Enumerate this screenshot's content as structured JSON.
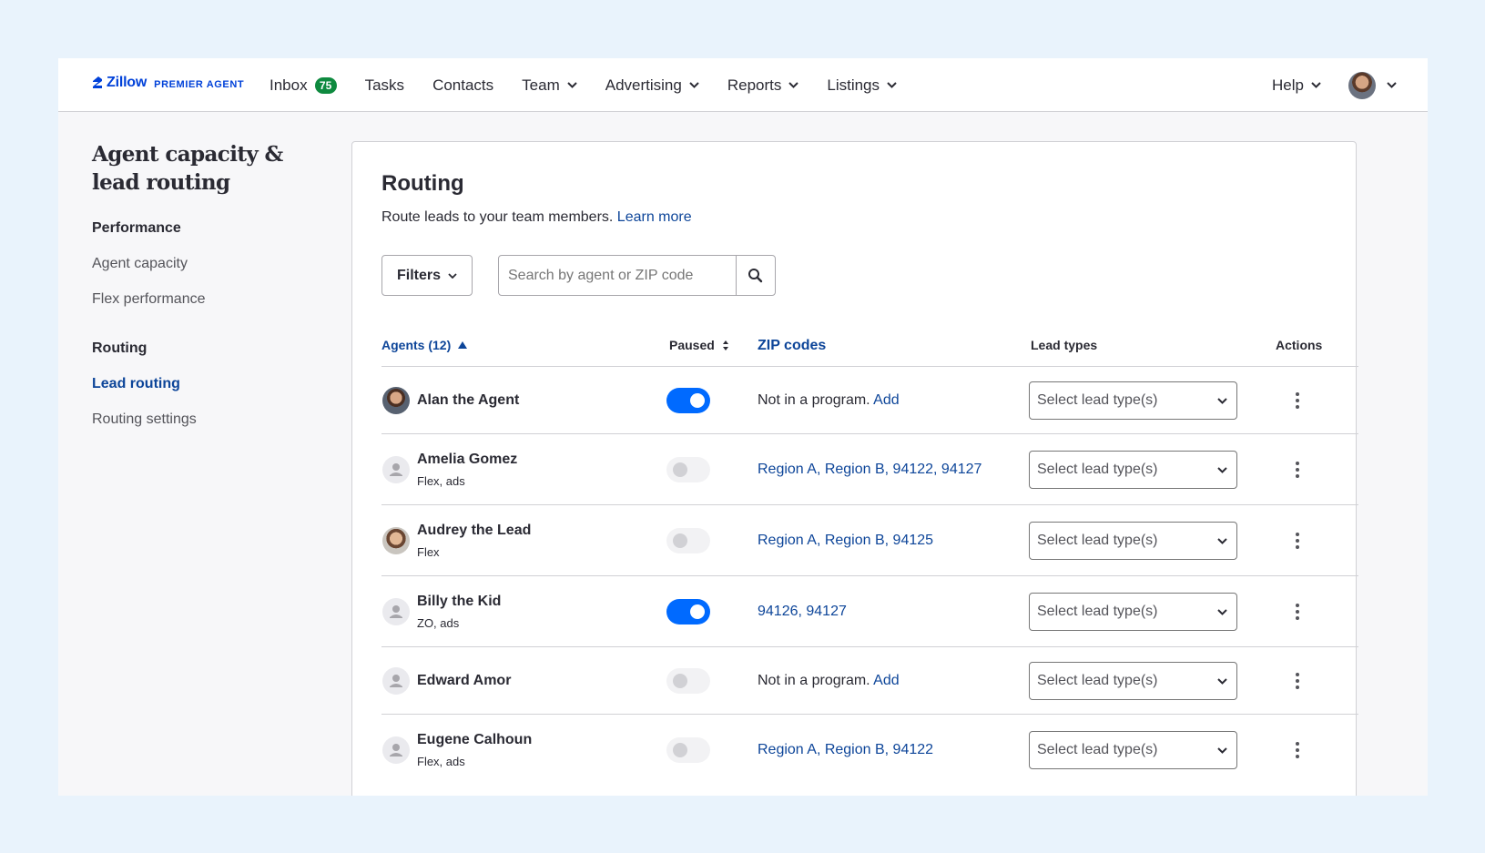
{
  "brand": {
    "name": "Zillow",
    "product": "PREMIER AGENT",
    "color": "#0041d9"
  },
  "nav": {
    "items": [
      {
        "label": "Inbox",
        "badge": "75",
        "dropdown": false
      },
      {
        "label": "Tasks",
        "dropdown": false
      },
      {
        "label": "Contacts",
        "dropdown": false
      },
      {
        "label": "Team",
        "dropdown": true
      },
      {
        "label": "Advertising",
        "dropdown": true
      },
      {
        "label": "Reports",
        "dropdown": true
      },
      {
        "label": "Listings",
        "dropdown": true
      }
    ],
    "help_label": "Help"
  },
  "sidebar": {
    "title": "Agent capacity & lead routing",
    "sections": [
      {
        "heading": "Performance",
        "links": [
          "Agent capacity",
          "Flex performance"
        ]
      },
      {
        "heading": "Routing",
        "links": [
          "Lead routing",
          "Routing settings"
        ]
      }
    ],
    "active_link": "Lead routing"
  },
  "main": {
    "title": "Routing",
    "subtitle": "Route leads to your team members.",
    "learn_more": "Learn more",
    "filters_label": "Filters",
    "search_placeholder": "Search by agent or ZIP code",
    "columns": {
      "agents": "Agents (12)",
      "paused": "Paused",
      "zip": "ZIP codes",
      "lead_types": "Lead types",
      "actions": "Actions"
    },
    "select_placeholder": "Select lead type(s)",
    "rows": [
      {
        "name": "Alan the Agent",
        "sub": "",
        "avatar": "photo",
        "paused": true,
        "zip_prefix": "Not in a program.",
        "zip_link": "Add"
      },
      {
        "name": "Amelia Gomez",
        "sub": "Flex, ads",
        "avatar": "placeholder",
        "paused": false,
        "zip_prefix": "",
        "zip_link": "Region A, Region B, 94122, 94127"
      },
      {
        "name": "Audrey the Lead",
        "sub": "Flex",
        "avatar": "photo",
        "paused": false,
        "zip_prefix": "",
        "zip_link": "Region A, Region B, 94125"
      },
      {
        "name": "Billy the Kid",
        "sub": "ZO, ads",
        "avatar": "placeholder",
        "paused": true,
        "zip_prefix": "",
        "zip_link": "94126, 94127"
      },
      {
        "name": "Edward Amor",
        "sub": "",
        "avatar": "placeholder",
        "paused": false,
        "zip_prefix": "Not in a program.",
        "zip_link": "Add"
      },
      {
        "name": "Eugene Calhoun",
        "sub": "Flex, ads",
        "avatar": "placeholder",
        "paused": false,
        "zip_prefix": "",
        "zip_link": "Region A, Region B, 94122"
      }
    ]
  },
  "colors": {
    "link": "#0d4599",
    "toggle_on": "#006aff",
    "badge": "#0e8a3f",
    "background": "#e9f3fc"
  }
}
